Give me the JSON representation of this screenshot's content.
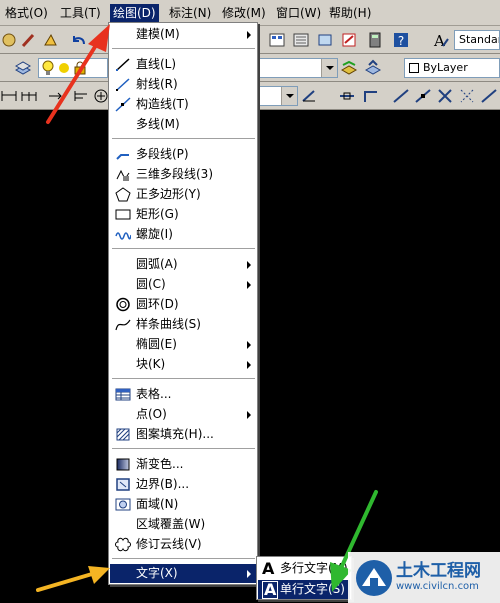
{
  "menubar": {
    "items": [
      "格式(O)",
      "工具(T)",
      "绘图(D)",
      "标注(N)",
      "修改(M)",
      "窗口(W)",
      "帮助(H)"
    ]
  },
  "toolbar": {
    "style_combo": "Standar",
    "layer_color": "ByLayer"
  },
  "draw_menu": {
    "items": [
      {
        "label": "建模(M)",
        "submenu": true,
        "icon": "none"
      },
      {
        "label": "直线(L)",
        "icon": "line-icon"
      },
      {
        "label": "射线(R)",
        "icon": "ray-icon"
      },
      {
        "label": "构造线(T)",
        "icon": "xline-icon"
      },
      {
        "label": "多线(M)",
        "icon": "none"
      },
      {
        "label": "多段线(P)",
        "icon": "polyline-icon"
      },
      {
        "label": "三维多段线(3)",
        "icon": "3dpoly-icon"
      },
      {
        "label": "正多边形(Y)",
        "icon": "polygon-icon"
      },
      {
        "label": "矩形(G)",
        "icon": "rectangle-icon"
      },
      {
        "label": "螺旋(I)",
        "icon": "helix-icon"
      },
      {
        "label": "圆弧(A)",
        "submenu": true,
        "icon": "none"
      },
      {
        "label": "圆(C)",
        "submenu": true,
        "icon": "none"
      },
      {
        "label": "圆环(D)",
        "icon": "donut-icon"
      },
      {
        "label": "样条曲线(S)",
        "icon": "spline-icon"
      },
      {
        "label": "椭圆(E)",
        "submenu": true,
        "icon": "none"
      },
      {
        "label": "块(K)",
        "submenu": true,
        "icon": "none"
      },
      {
        "label": "表格...",
        "icon": "table-icon"
      },
      {
        "label": "点(O)",
        "submenu": true,
        "icon": "none"
      },
      {
        "label": "图案填充(H)...",
        "icon": "hatch-icon"
      },
      {
        "label": "渐变色...",
        "icon": "gradient-icon"
      },
      {
        "label": "边界(B)...",
        "icon": "boundary-icon"
      },
      {
        "label": "面域(N)",
        "icon": "region-icon"
      },
      {
        "label": "区域覆盖(W)",
        "icon": "none"
      },
      {
        "label": "修订云线(V)",
        "icon": "revcloud-icon"
      },
      {
        "label": "文字(X)",
        "submenu": true,
        "selected": true,
        "icon": "none"
      }
    ]
  },
  "text_submenu": {
    "items": [
      {
        "label": "多行文字(M)...",
        "icon": "mtext-icon"
      },
      {
        "label": "单行文字(S)",
        "icon": "dtext-icon",
        "selected": true
      }
    ]
  },
  "annotations": {
    "colors": {
      "red": "#e8321e",
      "green": "#2fb82f",
      "orange": "#f4b423"
    }
  },
  "watermark": {
    "title": "土木工程网",
    "url": "www.civilcn.com"
  }
}
